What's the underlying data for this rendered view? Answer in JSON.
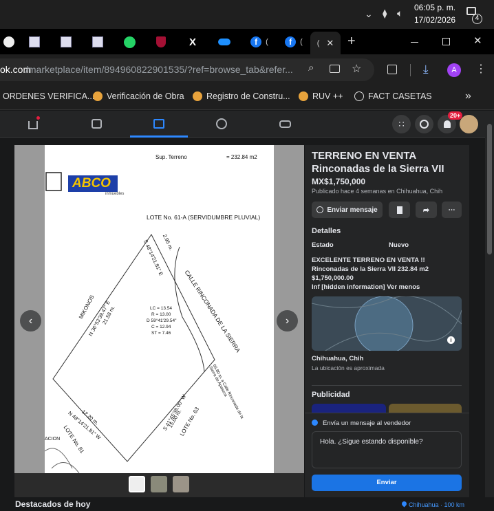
{
  "taskbar": {
    "time": "06:05 p. m.",
    "date": "17/02/2026",
    "notif_count": "4"
  },
  "browser": {
    "url_host": "ok.com",
    "url_path": "/marketplace/item/894960822901535/?ref=browse_tab&refer...",
    "active_tab_label": "(",
    "fb_tab_label": "(",
    "avatar_letter": "A",
    "bookmarks": [
      "ORDENES VERIFICA...",
      "Verificación de Obra",
      "Registro de Constru...",
      "RUV ++",
      "FACT CASETAS"
    ]
  },
  "fb": {
    "notif_badge": "20+"
  },
  "listing": {
    "title": "TERRENO EN VENTA Rinconadas de la Sierra VII",
    "price": "MX$1,750,000",
    "posted": "Publicado hace 4 semanas en Chihuahua, Chih",
    "send_msg_btn": "Enviar mensaje",
    "details_heading": "Detalles",
    "condition_label": "Estado",
    "condition_value": "Nuevo",
    "desc_line1": "EXCELENTE TERRENO EN VENTA !!",
    "desc_line2": "Rinconadas de la Sierra VII 232.84 m2",
    "desc_line3": "$1,750,000.00",
    "desc_line4_prefix": "Inf [hidden information]",
    "see_less": "Ver menos",
    "location": "Chihuahua, Chih",
    "location_note": "La ubicación es aproximada",
    "ads_heading": "Publicidad",
    "message_prompt": "Envía un mensaje al vendedor",
    "message_value": "Hola. ¿Sigue estando disponible?",
    "send_btn": "Enviar"
  },
  "photo": {
    "brand": "ABCO",
    "brand_sub": "inmuebles",
    "sup_label": "Sup. Terreno",
    "sup_value": "= 232.84 m2",
    "lote_top": "LOTE No. 61-A (SERVIDUMBRE PLUVIAL)",
    "bearing_top": "S 48°14'21.81\" E",
    "dist_top": "2.95 m.",
    "street": "CALLE RINCONADA DE LA SIERRA",
    "mikonos": "MIKONOS",
    "bearing_left": "N 36°53'39.47\" E",
    "dist_left": "21.58 m.",
    "curve_lc": "LC = 13.54",
    "curve_r": "R = 13.00",
    "curve_d": "D 59°41'29.54\"",
    "curve_c": "C = 12.94",
    "curve_st": "ST = 7.46",
    "dist_bottom": "12.20 m.",
    "bearing_bottom": "N 48°14'21.81\" W",
    "lote_81": "LOTE No. 81",
    "dist_right": "15.00 m.",
    "bearing_right": "S 41°45'38.00\" W",
    "lote_63": "LOTE No. 63",
    "note_right": "66.80 m. a Calle Rinconada de la Sierra de Apaseca",
    "acion": "ACION"
  },
  "footer": {
    "featured": "Destacados de hoy",
    "location_radius": "Chihuahua · 100 km"
  }
}
